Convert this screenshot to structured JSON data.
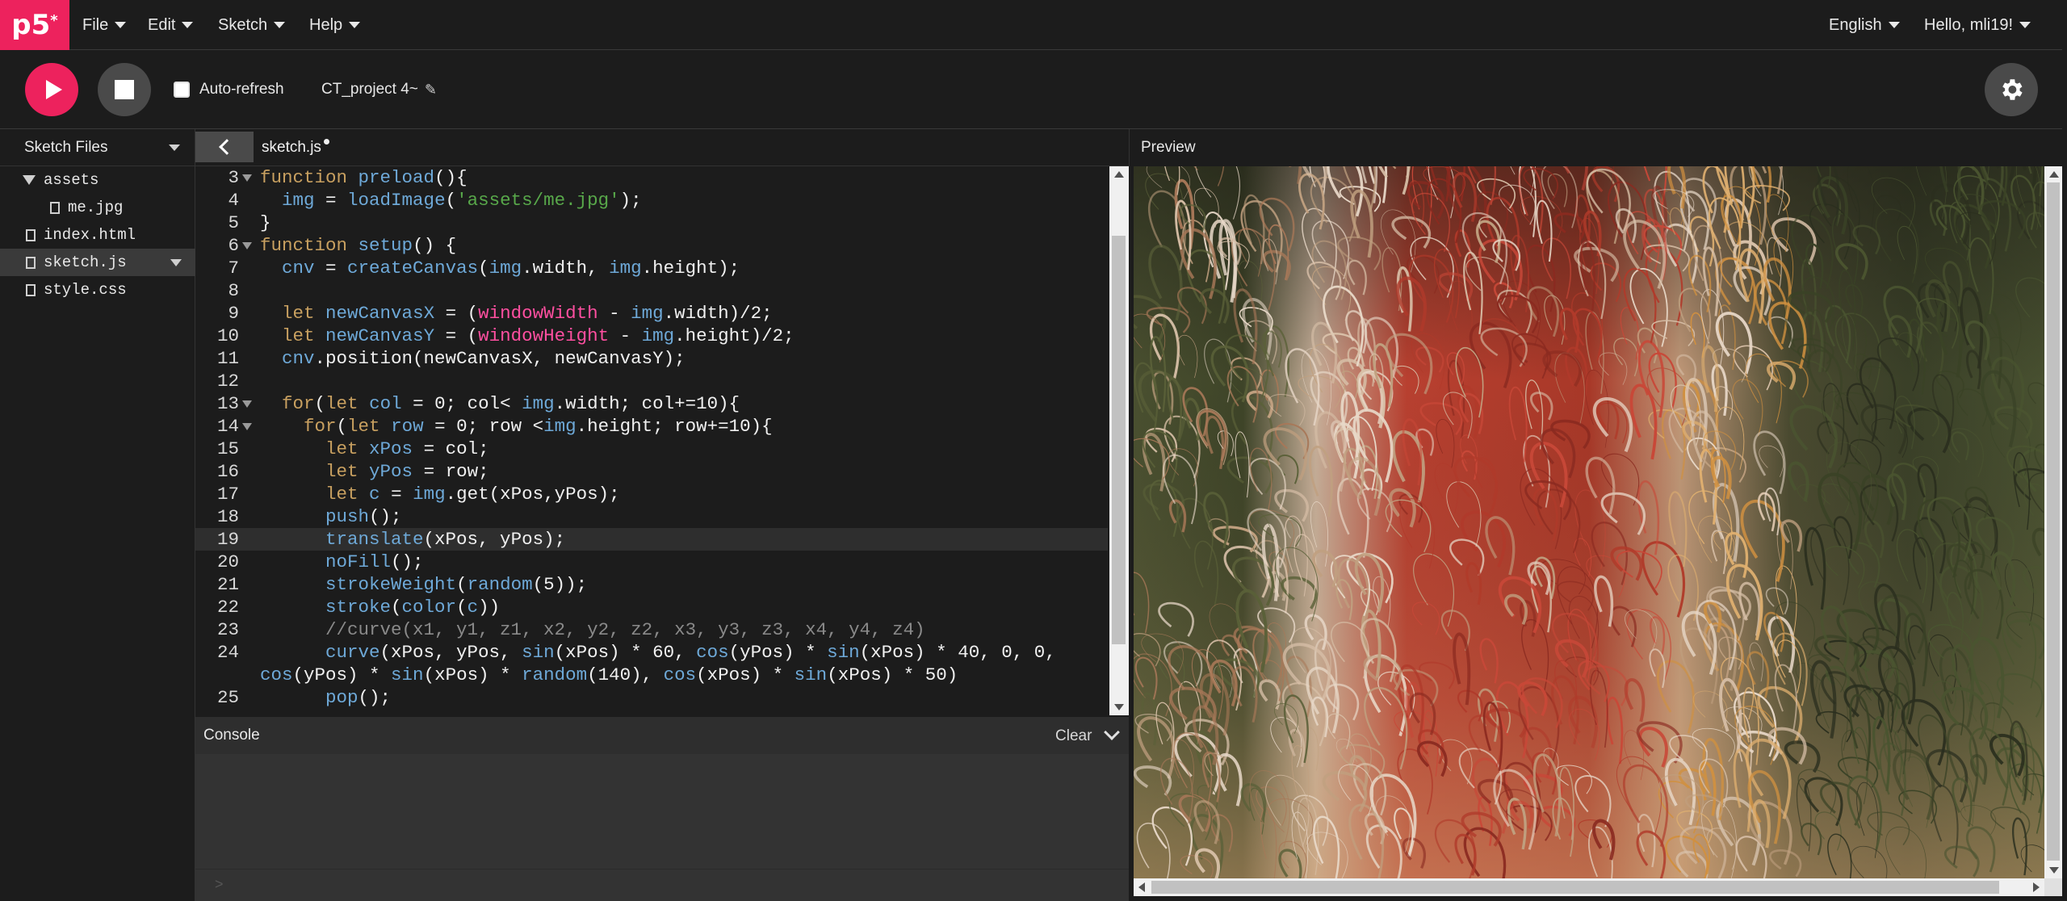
{
  "nav": {
    "logo": "p5",
    "logo_star": "*",
    "menus": [
      {
        "label": "File"
      },
      {
        "label": "Edit"
      },
      {
        "label": "Sketch"
      },
      {
        "label": "Help"
      }
    ],
    "language": "English",
    "user": "Hello, mli19!"
  },
  "toolbar": {
    "auto_refresh_label": "Auto-refresh",
    "auto_refresh_checked": false,
    "project_name": "CT_project 4~"
  },
  "sidebar": {
    "title": "Sketch Files",
    "files": [
      {
        "name": "assets",
        "type": "folder"
      },
      {
        "name": "me.jpg",
        "type": "file"
      },
      {
        "name": "index.html",
        "type": "file"
      },
      {
        "name": "sketch.js",
        "type": "file",
        "selected": true
      },
      {
        "name": "style.css",
        "type": "file"
      }
    ]
  },
  "editor": {
    "tab_label": "sketch.js",
    "lines": [
      {
        "num": "3",
        "text": "function preload(){"
      },
      {
        "num": "4",
        "text": "  img = loadImage('assets/me.jpg');"
      },
      {
        "num": "5",
        "text": "}"
      },
      {
        "num": "6",
        "text": "function setup() {"
      },
      {
        "num": "7",
        "text": "  cnv = createCanvas(img.width, img.height);"
      },
      {
        "num": "8",
        "text": ""
      },
      {
        "num": "9",
        "text": "  let newCanvasX = (windowWidth - img.width)/2;"
      },
      {
        "num": "10",
        "text": "  let newCanvasY = (windowHeight - img.height)/2;"
      },
      {
        "num": "11",
        "text": "  cnv.position(newCanvasX, newCanvasY);"
      },
      {
        "num": "12",
        "text": ""
      },
      {
        "num": "13",
        "text": "  for(let col = 0; col< img.width; col+=10){"
      },
      {
        "num": "14",
        "text": "    for(let row = 0; row <img.height; row+=10){"
      },
      {
        "num": "15",
        "text": "      let xPos = col;"
      },
      {
        "num": "16",
        "text": "      let yPos = row;"
      },
      {
        "num": "17",
        "text": "      let c = img.get(xPos,yPos);"
      },
      {
        "num": "18",
        "text": "      push();"
      },
      {
        "num": "19",
        "text": "      translate(xPos, yPos);"
      },
      {
        "num": "20",
        "text": "      noFill();"
      },
      {
        "num": "21",
        "text": "      strokeWeight(random(5));"
      },
      {
        "num": "22",
        "text": "      stroke(color(c))"
      },
      {
        "num": "23",
        "text": "      //curve(x1, y1, z1, x2, y2, z2, x3, y3, z3, x4, y4, z4)"
      },
      {
        "num": "24",
        "text": "      curve(xPos, yPos, sin(xPos) * 60, cos(yPos) * sin(xPos) * 40, 0, 0,"
      },
      {
        "num": "",
        "text": "cos(yPos) * sin(xPos) * random(140), cos(xPos) * sin(xPos) * 50)"
      },
      {
        "num": "25",
        "text": "      pop();"
      }
    ]
  },
  "console": {
    "title": "Console",
    "clear_label": "Clear",
    "prompt": ">"
  },
  "preview": {
    "title": "Preview"
  },
  "colors": {
    "accent": "#ed225d",
    "background": "#1c1c1c",
    "keyword": "#c8a060",
    "function": "#6ea9d8",
    "string": "#58a84a",
    "global": "#ff4fa0",
    "comment": "#8a8a8a"
  }
}
